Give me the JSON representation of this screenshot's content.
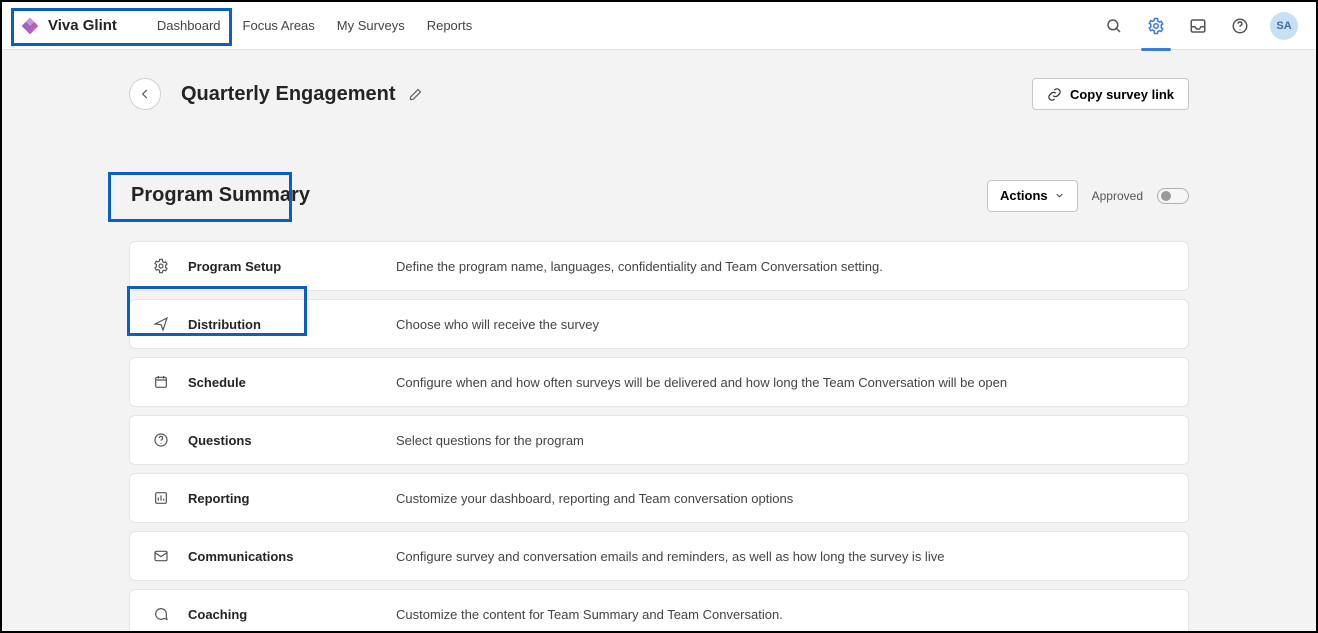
{
  "brand": "Viva Glint",
  "nav": {
    "items": [
      "Dashboard",
      "Focus Areas",
      "My Surveys",
      "Reports"
    ]
  },
  "avatar_initials": "SA",
  "header": {
    "title": "Quarterly Engagement",
    "copy_button": "Copy survey link"
  },
  "section": {
    "title": "Program Summary",
    "actions_button": "Actions",
    "approved_label": "Approved"
  },
  "rows": [
    {
      "icon": "gear",
      "title": "Program Setup",
      "desc": "Define the program name, languages, confidentiality and Team Conversation setting."
    },
    {
      "icon": "send",
      "title": "Distribution",
      "desc": "Choose who will receive the survey"
    },
    {
      "icon": "calendar",
      "title": "Schedule",
      "desc": "Configure when and how often surveys will be delivered and how long the Team Conversation will be open"
    },
    {
      "icon": "question",
      "title": "Questions",
      "desc": "Select questions for the program"
    },
    {
      "icon": "chart",
      "title": "Reporting",
      "desc": "Customize your dashboard, reporting and Team conversation options"
    },
    {
      "icon": "mail",
      "title": "Communications",
      "desc": "Configure survey and conversation emails and reminders, as well as how long the survey is live"
    },
    {
      "icon": "chat",
      "title": "Coaching",
      "desc": "Customize the content for Team Summary and Team Conversation."
    }
  ]
}
